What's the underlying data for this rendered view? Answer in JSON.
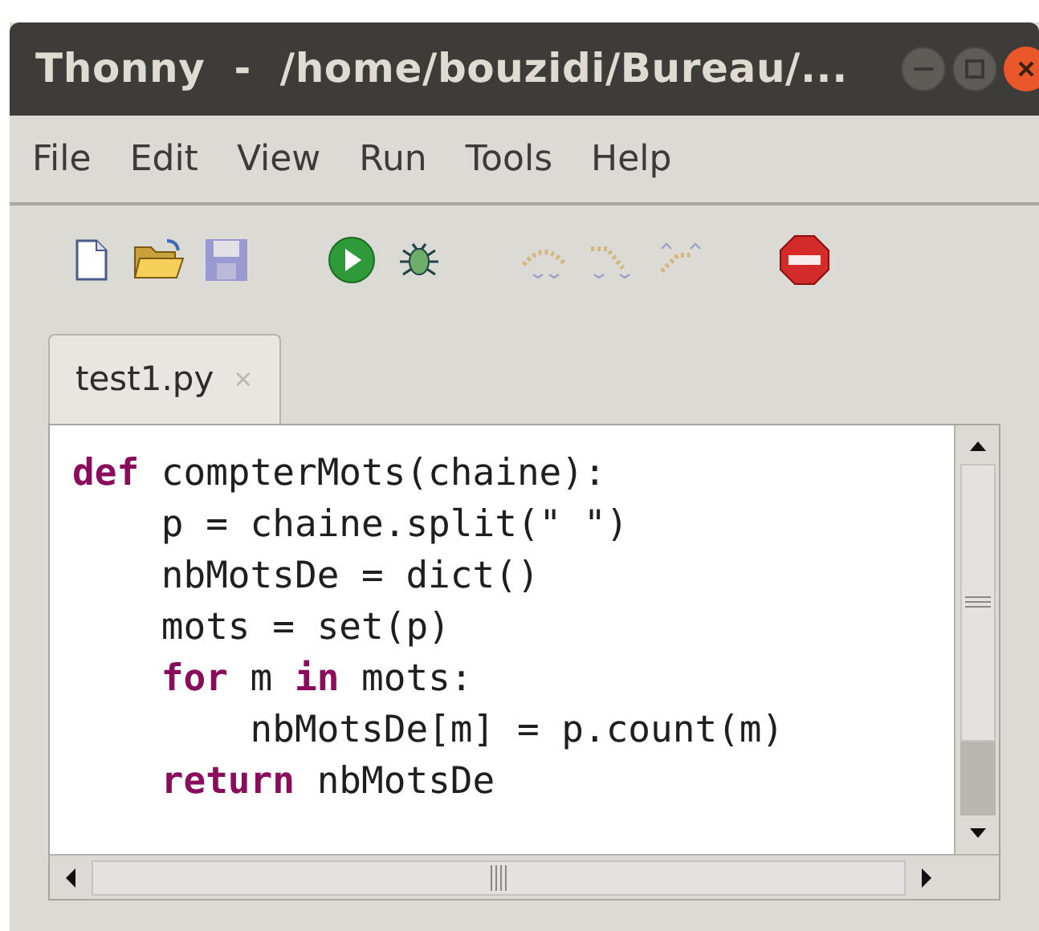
{
  "window": {
    "title": "Thonny  -  /home/bouzidi/Bureau/..."
  },
  "menu": [
    "File",
    "Edit",
    "View",
    "Run",
    "Tools",
    "Help"
  ],
  "toolbar": [
    {
      "kind": "new",
      "disabled": false
    },
    {
      "kind": "open",
      "disabled": false
    },
    {
      "kind": "save",
      "disabled": true
    },
    {
      "kind": "run",
      "disabled": false
    },
    {
      "kind": "debug",
      "disabled": false
    },
    {
      "kind": "step-over",
      "disabled": true
    },
    {
      "kind": "step-into",
      "disabled": true
    },
    {
      "kind": "step-out",
      "disabled": true
    },
    {
      "kind": "stop",
      "disabled": false
    }
  ],
  "tabs": [
    {
      "label": "test1.py",
      "close": "×",
      "selected": true
    }
  ],
  "editor": {
    "lines": [
      [
        {
          "kind": "keyword",
          "text": "def"
        },
        {
          "kind": "plain",
          "text": " compterMots(chaine):"
        }
      ],
      [
        {
          "kind": "plain",
          "text": "    p = chaine.split(\" \")"
        }
      ],
      [
        {
          "kind": "plain",
          "text": "    nbMotsDe = dict()"
        }
      ],
      [
        {
          "kind": "plain",
          "text": "    mots = set(p)"
        }
      ],
      [
        {
          "kind": "keyword",
          "text": "    for"
        },
        {
          "kind": "plain",
          "text": " m "
        },
        {
          "kind": "keyword",
          "text": "in"
        },
        {
          "kind": "plain",
          "text": " mots:"
        }
      ],
      [
        {
          "kind": "plain",
          "text": "        nbMotsDe[m] = p.count(m)"
        }
      ],
      [
        {
          "kind": "keyword",
          "text": "    return"
        },
        {
          "kind": "plain",
          "text": " nbMotsDe"
        }
      ]
    ]
  }
}
